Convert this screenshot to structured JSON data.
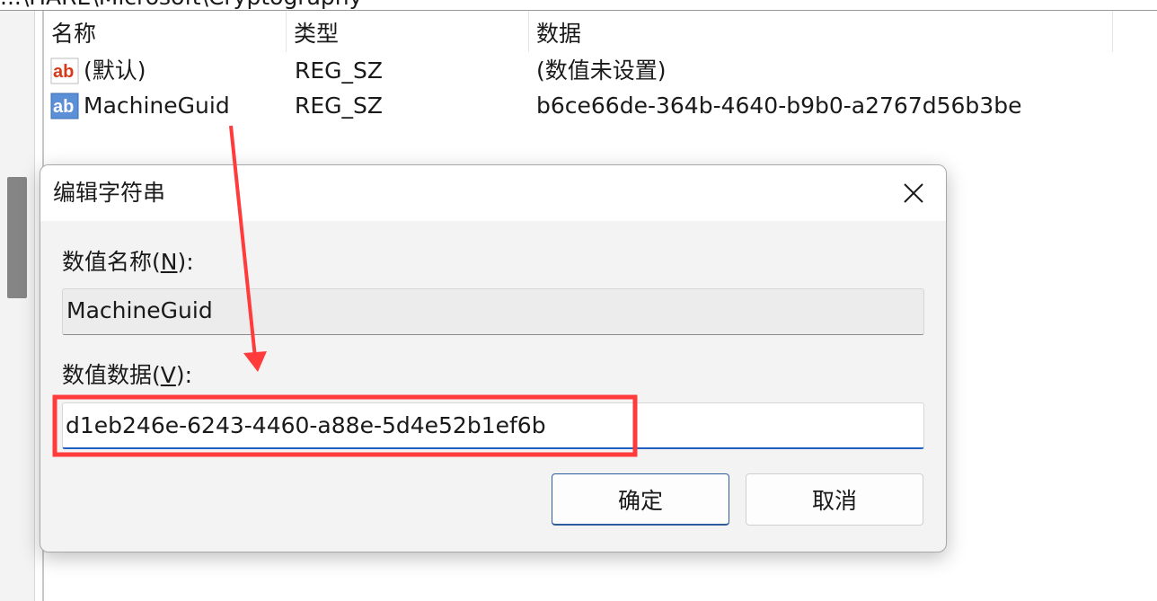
{
  "window": {
    "path_text": "...\\HARE\\Microsoft\\Cryptography"
  },
  "list": {
    "headers": [
      "名称",
      "类型",
      "数据"
    ],
    "rows": [
      {
        "name": "(默认)",
        "type": "REG_SZ",
        "data": "(数值未设置)",
        "icon": "reg-string-icon"
      },
      {
        "name": "MachineGuid",
        "type": "REG_SZ",
        "data": "b6ce66de-364b-4640-b9b0-a2767d56b3be",
        "icon": "reg-string-icon"
      }
    ]
  },
  "dialog": {
    "title": "编辑字符串",
    "close_icon": "close-icon",
    "name_label": "数值名称(",
    "name_label_hotkey": "N",
    "name_label_end": "):",
    "name_value": "MachineGuid",
    "data_label": "数值数据(",
    "data_label_hotkey": "V",
    "data_label_end": "):",
    "data_value": "d1eb246e-6243-4460-a88e-5d4e52b1ef6b",
    "ok_label": "确定",
    "cancel_label": "取消"
  },
  "colors": {
    "annotation_red": "#ff3b3b",
    "input_focus_blue": "#1f5fbf",
    "dialog_bg": "#f3f3f3"
  }
}
